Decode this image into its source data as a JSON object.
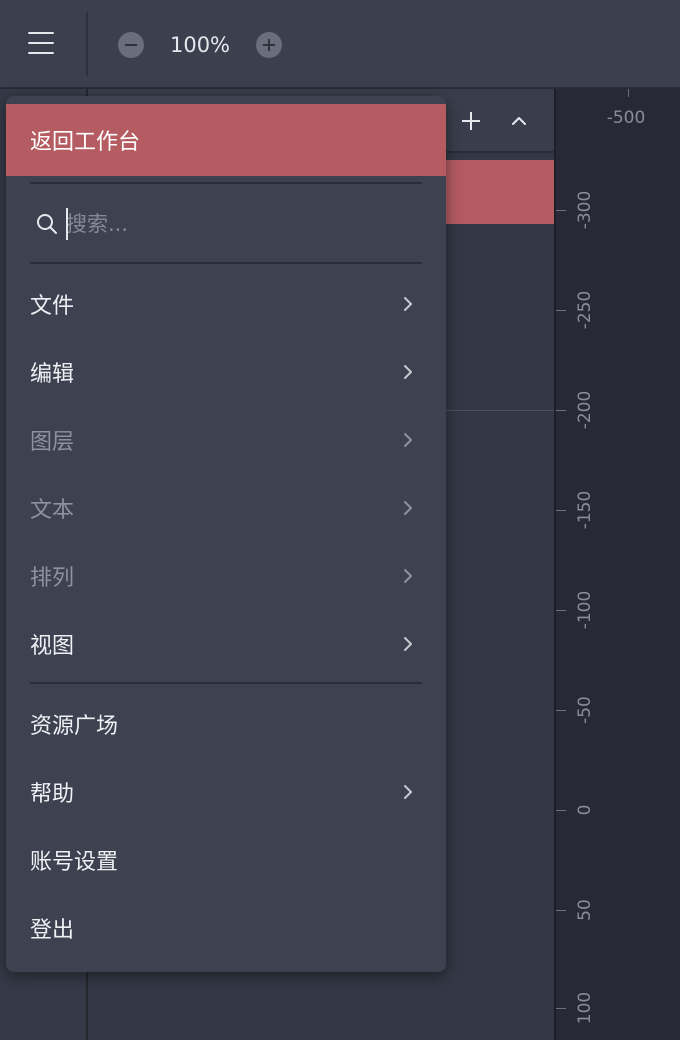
{
  "toolbar": {
    "zoom_value": "100%",
    "menu_icon": "hamburger-menu-icon",
    "zoom_out_icon": "minus-circle-icon",
    "zoom_in_icon": "plus-circle-icon"
  },
  "layer_panel": {
    "add_icon": "plus-icon",
    "collapse_icon": "chevron-up-icon",
    "selected_color": "#b55c63"
  },
  "ruler": {
    "top_label": "-500",
    "labels": [
      "-300",
      "-250",
      "-200",
      "-150",
      "-100",
      "-50",
      "0",
      "50",
      "100"
    ]
  },
  "menu": {
    "back_label": "返回工作台",
    "search_placeholder": "搜索...",
    "items": [
      {
        "label": "文件",
        "disabled": false,
        "has_submenu": true
      },
      {
        "label": "编辑",
        "disabled": false,
        "has_submenu": true
      },
      {
        "label": "图层",
        "disabled": true,
        "has_submenu": true
      },
      {
        "label": "文本",
        "disabled": true,
        "has_submenu": true
      },
      {
        "label": "排列",
        "disabled": true,
        "has_submenu": true
      },
      {
        "label": "视图",
        "disabled": false,
        "has_submenu": true
      }
    ],
    "items2": [
      {
        "label": "资源广场",
        "disabled": false,
        "has_submenu": false
      },
      {
        "label": "帮助",
        "disabled": false,
        "has_submenu": true
      },
      {
        "label": "账号设置",
        "disabled": false,
        "has_submenu": false
      },
      {
        "label": "登出",
        "disabled": false,
        "has_submenu": false
      }
    ]
  },
  "colors": {
    "accent": "#b55c63",
    "menu_bg": "#3d4150",
    "toolbar_bg": "#3c404e",
    "canvas_bg": "#272a36"
  }
}
